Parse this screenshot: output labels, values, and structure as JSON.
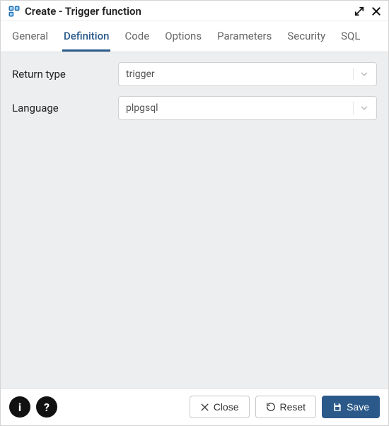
{
  "title": "Create - Trigger function",
  "tabs": [
    {
      "label": "General"
    },
    {
      "label": "Definition"
    },
    {
      "label": "Code"
    },
    {
      "label": "Options"
    },
    {
      "label": "Parameters"
    },
    {
      "label": "Security"
    },
    {
      "label": "SQL"
    }
  ],
  "active_tab_index": 1,
  "form": {
    "return_type": {
      "label": "Return type",
      "value": "trigger"
    },
    "language": {
      "label": "Language",
      "value": "plpgsql"
    }
  },
  "footer": {
    "close_label": "Close",
    "reset_label": "Reset",
    "save_label": "Save"
  }
}
